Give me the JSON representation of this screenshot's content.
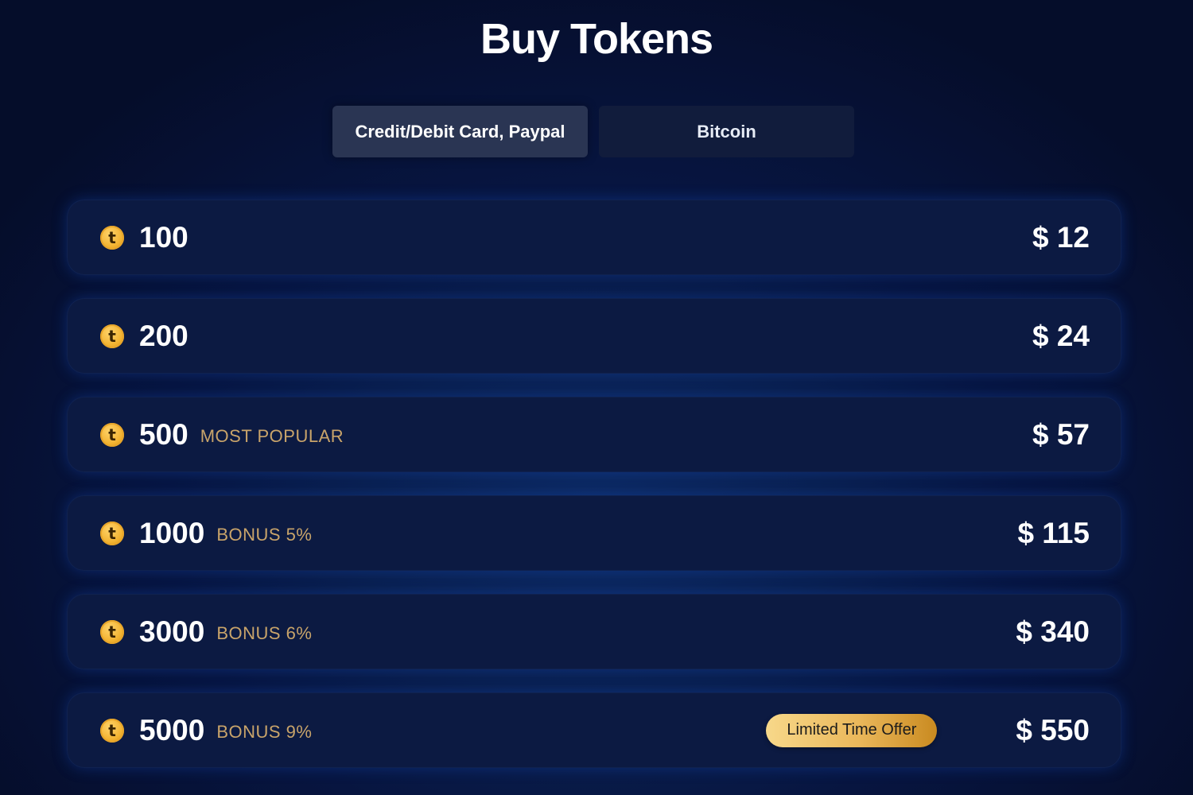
{
  "page": {
    "title": "Buy Tokens"
  },
  "tabs": [
    {
      "label": "Credit/Debit Card, Paypal",
      "active": true
    },
    {
      "label": "Bitcoin",
      "active": false
    }
  ],
  "packages": [
    {
      "amount": "100",
      "tag": "",
      "badge": "",
      "price": "$ 12"
    },
    {
      "amount": "200",
      "tag": "",
      "badge": "",
      "price": "$ 24"
    },
    {
      "amount": "500",
      "tag": "MOST POPULAR",
      "badge": "",
      "price": "$ 57"
    },
    {
      "amount": "1000",
      "tag": "BONUS 5%",
      "badge": "",
      "price": "$ 115"
    },
    {
      "amount": "3000",
      "tag": "BONUS 6%",
      "badge": "",
      "price": "$ 340"
    },
    {
      "amount": "5000",
      "tag": "BONUS 9%",
      "badge": "Limited Time Offer",
      "price": "$ 550"
    }
  ],
  "icons": {
    "coin": "token-coin-icon",
    "coin_glyph": "t"
  },
  "colors": {
    "background": "#071540",
    "row_background": "#0c1a42",
    "tag_gold": "#c9a46a",
    "badge_gold": "#eab75a",
    "coin_gold": "#f2b230"
  }
}
